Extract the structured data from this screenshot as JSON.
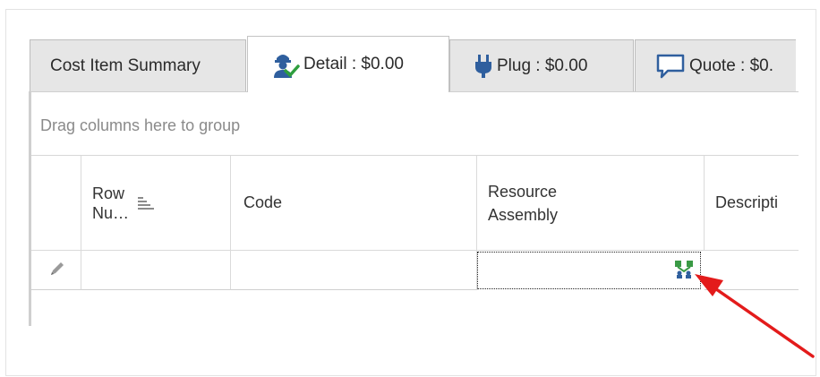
{
  "tabs": [
    {
      "label": "Cost Item Summary",
      "active": false,
      "icon": "none"
    },
    {
      "label": "Detail : $0.00",
      "active": true,
      "icon": "worker-check-icon"
    },
    {
      "label": "Plug : $0.00",
      "active": false,
      "icon": "plug-icon"
    },
    {
      "label": "Quote : $0.",
      "active": false,
      "icon": "speech-bubble-icon"
    }
  ],
  "group_bar": {
    "text": "Drag columns here to group"
  },
  "columns": [
    {
      "label": "Row\nNu…",
      "sortable": true
    },
    {
      "label": "Code"
    },
    {
      "label": "Resource\nAssembly"
    },
    {
      "label": "Descripti"
    }
  ],
  "row": {
    "edit_icon": "pencil-icon",
    "lookup_icon": "resource-lookup-icon"
  },
  "annotation": {
    "type": "red-arrow",
    "color": "#e31b1b"
  }
}
